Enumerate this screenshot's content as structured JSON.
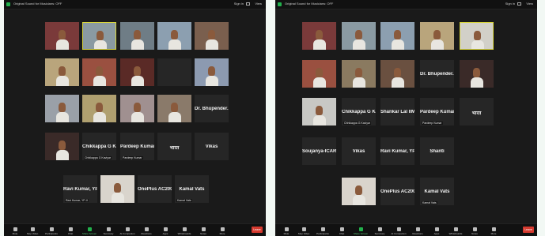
{
  "panels": [
    {
      "topbar": {
        "audio": "Original Sound for Musicians: OFF",
        "signin": "Sign in",
        "view": "View"
      },
      "tiles": [
        {
          "name": "",
          "big": "",
          "video": true,
          "bg": "#7a3a3a"
        },
        {
          "name": "",
          "big": "",
          "video": true,
          "bg": "#8a9aa2",
          "active": true
        },
        {
          "name": "",
          "big": "",
          "video": true,
          "bg": "#6f7d86"
        },
        {
          "name": "",
          "big": "",
          "video": true,
          "bg": "#8c9fb0"
        },
        {
          "name": "",
          "big": "",
          "video": true,
          "bg": "#7a5f4e"
        },
        {
          "name": "",
          "big": "",
          "video": true,
          "bg": "#b9a57c"
        },
        {
          "name": "",
          "big": "",
          "video": true,
          "bg": "#9a5040"
        },
        {
          "name": "",
          "big": "",
          "video": true,
          "bg": "#5a2a26"
        },
        {
          "name": "",
          "big": "",
          "video": false,
          "bg": "#000000"
        },
        {
          "name": "",
          "big": "",
          "video": true,
          "bg": "#8c9ab0"
        },
        {
          "name": "",
          "big": "",
          "video": true,
          "bg": "#9aa0a8"
        },
        {
          "name": "",
          "big": "",
          "video": true,
          "bg": "#b0a070"
        },
        {
          "name": "",
          "big": "",
          "video": true,
          "bg": "#a09090"
        },
        {
          "name": "",
          "big": "",
          "video": true,
          "bg": "#8a7a6a"
        },
        {
          "name": "",
          "big": "Dr. Bhupender...",
          "video": false
        },
        {
          "name": "",
          "big": "",
          "video": true,
          "bg": "#3a2a28"
        },
        {
          "name": "Chhikappa G Kaviyar",
          "big": "Chikkappa G Ka...",
          "video": false
        },
        {
          "name": "Pardeep Kumar",
          "big": "Pardeep Kumar",
          "video": false
        },
        {
          "name": "",
          "big": "भारत",
          "video": false
        },
        {
          "name": "",
          "big": "Vikas",
          "video": false
        },
        {
          "name": "Ravi Kumar, YP-II",
          "big": "Ravi Kumar, YP-II",
          "video": false
        },
        {
          "name": "",
          "big": "",
          "video": true,
          "bg": "#d9d4cc"
        },
        {
          "name": "",
          "big": "OnePlus AC2001",
          "video": false
        },
        {
          "name": "Kamal Vats",
          "big": "Kamal Vats",
          "video": false
        }
      ]
    },
    {
      "topbar": {
        "audio": "Original Sound for Musicians: OFF",
        "signin": "Sign in",
        "view": "View"
      },
      "tiles": [
        {
          "name": "",
          "big": "",
          "video": true,
          "bg": "#7a3a3a"
        },
        {
          "name": "",
          "big": "",
          "video": true,
          "bg": "#8a9aa2"
        },
        {
          "name": "",
          "big": "",
          "video": true,
          "bg": "#8c9fb0"
        },
        {
          "name": "",
          "big": "",
          "video": true,
          "bg": "#b9a57c"
        },
        {
          "name": "",
          "big": "",
          "video": true,
          "bg": "#d2d0c8",
          "active": true
        },
        {
          "name": "",
          "big": "",
          "video": true,
          "bg": "#9a5040"
        },
        {
          "name": "",
          "big": "",
          "video": true,
          "bg": "#8a7a60"
        },
        {
          "name": "",
          "big": "",
          "video": true,
          "bg": "#6a5040"
        },
        {
          "name": "",
          "big": "Dr. Bhupender...",
          "video": false
        },
        {
          "name": "",
          "big": "",
          "video": true,
          "bg": "#3a2a28"
        },
        {
          "name": "",
          "big": "",
          "video": true,
          "bg": "#c8c8c4"
        },
        {
          "name": "Chhikappa G Kaviyar",
          "big": "Chikkappa G Ka...",
          "video": false
        },
        {
          "name": "",
          "big": "Shankar Lal IIMR",
          "video": false
        },
        {
          "name": "Pardeep Kumar",
          "big": "Pardeep Kumar",
          "video": false
        },
        {
          "name": "",
          "big": "भारत",
          "video": false
        },
        {
          "name": "",
          "big": "Soujanya-ICAR-...",
          "video": false
        },
        {
          "name": "",
          "big": "Vikas",
          "video": false
        },
        {
          "name": "",
          "big": "Ravi Kumar, YP-II",
          "video": false
        },
        {
          "name": "",
          "big": "Shanti",
          "video": false
        },
        {
          "name": "",
          "big": "",
          "video": true,
          "bg": "#d9d4cc"
        },
        {
          "name": "",
          "big": "OnePlus AC2001",
          "video": false
        },
        {
          "name": "Kamal Vats",
          "big": "Kamal Vats",
          "video": false
        }
      ]
    }
  ],
  "toolbar": {
    "items": [
      "Mute",
      "Stop Video",
      "Participants",
      "Chat",
      "Share Screen",
      "Summary",
      "AI Companion",
      "Reactions",
      "Apps",
      "Whiteboards",
      "Notes",
      "More"
    ],
    "leave": "Leave"
  }
}
